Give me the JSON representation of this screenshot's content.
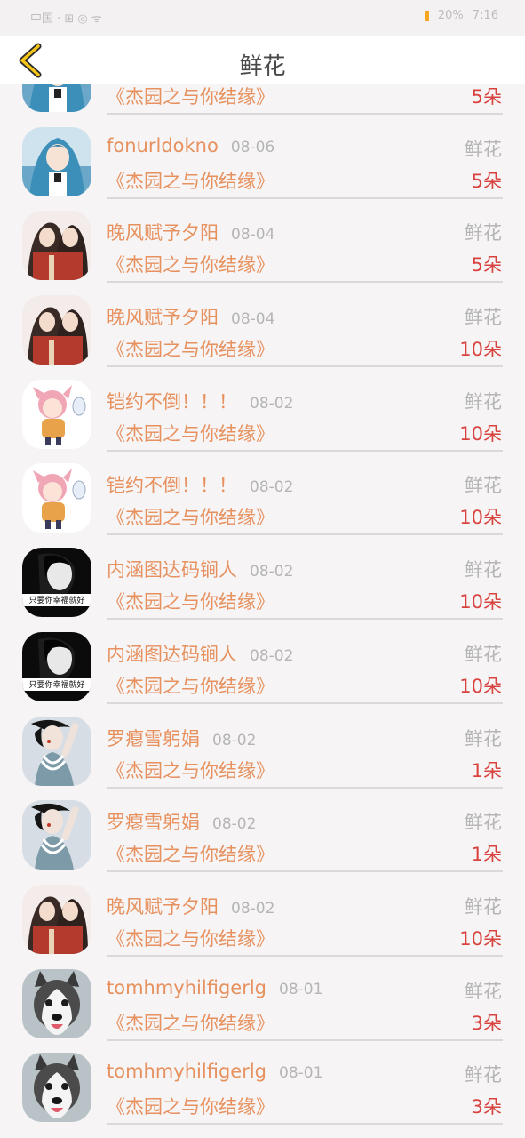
{
  "status": {
    "left": "中国 · ⊞ ◎ ᯤ",
    "battery": "20%",
    "time": "7:16"
  },
  "header": {
    "title": "鲜花"
  },
  "colors": {
    "accent": "#e7915f",
    "quantity": "#d8433f",
    "muted": "#b5b5b5"
  },
  "records": [
    {
      "name": "",
      "date": "",
      "type": "",
      "work": "《杰园之与你结缘》",
      "qty": "5朵",
      "avatar": "anime-girl-blue"
    },
    {
      "name": "fonurldokno",
      "date": "08-06",
      "type": "鲜花",
      "work": "《杰园之与你结缘》",
      "qty": "5朵",
      "avatar": "anime-girl-blue"
    },
    {
      "name": "晚风赋予夕阳",
      "date": "08-04",
      "type": "鲜花",
      "work": "《杰园之与你结缘》",
      "qty": "5朵",
      "avatar": "anime-couple-red"
    },
    {
      "name": "晚风赋予夕阳",
      "date": "08-04",
      "type": "鲜花",
      "work": "《杰园之与你结缘》",
      "qty": "10朵",
      "avatar": "anime-couple-red"
    },
    {
      "name": "铠约不倒！！！",
      "date": "08-02",
      "type": "鲜花",
      "work": "《杰园之与你结缘》",
      "qty": "10朵",
      "avatar": "chibi-pink"
    },
    {
      "name": "铠约不倒！！！",
      "date": "08-02",
      "type": "鲜花",
      "work": "《杰园之与你结缘》",
      "qty": "10朵",
      "avatar": "chibi-pink"
    },
    {
      "name": "内涵图达码锏人",
      "date": "08-02",
      "type": "鲜花",
      "work": "《杰园之与你结缘》",
      "qty": "10朵",
      "avatar": "bw-face"
    },
    {
      "name": "内涵图达码锏人",
      "date": "08-02",
      "type": "鲜花",
      "work": "《杰园之与你结缘》",
      "qty": "10朵",
      "avatar": "bw-face"
    },
    {
      "name": "罗瘪雪躬娟",
      "date": "08-02",
      "type": "鲜花",
      "work": "《杰园之与你结缘》",
      "qty": "1朵",
      "avatar": "fashion-woman"
    },
    {
      "name": "罗瘪雪躬娟",
      "date": "08-02",
      "type": "鲜花",
      "work": "《杰园之与你结缘》",
      "qty": "1朵",
      "avatar": "fashion-woman"
    },
    {
      "name": "晚风赋予夕阳",
      "date": "08-02",
      "type": "鲜花",
      "work": "《杰园之与你结缘》",
      "qty": "10朵",
      "avatar": "anime-couple-red"
    },
    {
      "name": "tomhmyhilfigerlg",
      "date": "08-01",
      "type": "鲜花",
      "work": "《杰园之与你结缘》",
      "qty": "3朵",
      "avatar": "husky-dog"
    },
    {
      "name": "tomhmyhilfigerlg",
      "date": "08-01",
      "type": "鲜花",
      "work": "《杰园之与你结缘》",
      "qty": "3朵",
      "avatar": "husky-dog"
    }
  ],
  "avatar_captions": {
    "bw-face": "只要你幸福就好"
  }
}
